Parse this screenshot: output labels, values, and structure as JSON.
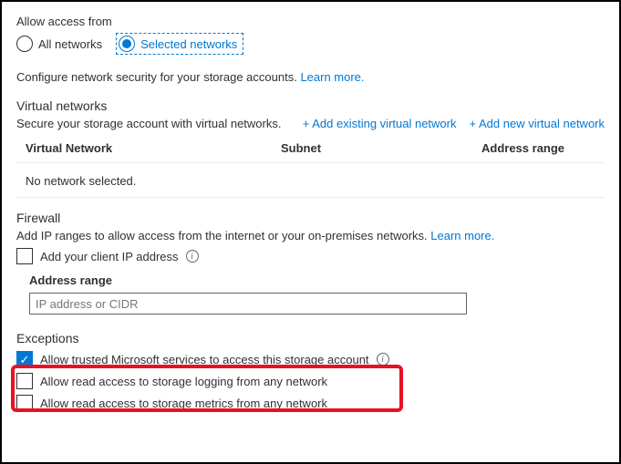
{
  "access": {
    "label": "Allow access from",
    "options": {
      "all": "All networks",
      "selected": "Selected networks"
    }
  },
  "configure": {
    "text": "Configure network security for your storage accounts. ",
    "learn_more": "Learn more."
  },
  "vnet": {
    "header": "Virtual networks",
    "desc": "Secure your storage account with virtual networks.",
    "add_existing": "+ Add existing virtual network",
    "add_new": "+ Add new virtual network",
    "col_vn": "Virtual Network",
    "col_subnet": "Subnet",
    "col_addr": "Address range",
    "empty": "No network selected."
  },
  "firewall": {
    "header": "Firewall",
    "desc": "Add IP ranges to allow access from the internet or your on-premises networks. ",
    "learn_more": "Learn more.",
    "add_client_ip": "Add your client IP address",
    "addr_label": "Address range",
    "placeholder": "IP address or CIDR"
  },
  "exceptions": {
    "header": "Exceptions",
    "trusted": "Allow trusted Microsoft services to access this storage account",
    "logging": "Allow read access to storage logging from any network",
    "metrics": "Allow read access to storage metrics from any network"
  }
}
